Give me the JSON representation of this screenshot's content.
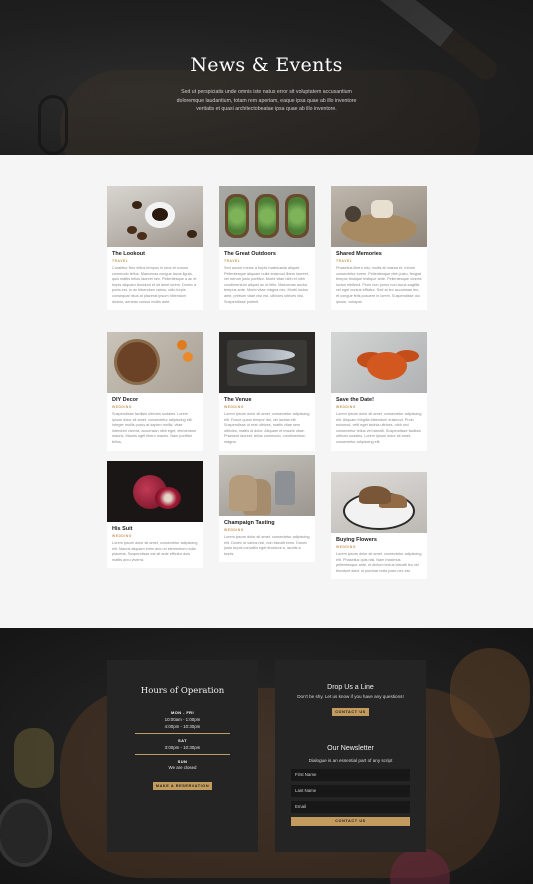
{
  "hero": {
    "title": "News & Events",
    "text": "Sed ut perspiciatis unde omnis iste natus error sit voluptatem accusantium doloremque laudantium, totam rem aperiam, eaque ipsa quae ab illo inventore veritatis et quasi architectobeatae ipsa quae ab illo inventore."
  },
  "posts": [
    {
      "title": "The Lookout",
      "category": "TRAVEL",
      "excerpt": "Curabitur Nec tellus tempus in urna et cursus commodo tellus. Maecenas congue lacus ligula, quis mattis tellus laoreet nec. Pellentesque a ac et turpis aliquam tincidunt et sit amet lorem. Donec a porta est. In ac bibendum varius, odio turpis consequat risus at placerat ipsum bibendum dictum, aenean cursus mollis ante."
    },
    {
      "title": "The Great Outdoors",
      "category": "TRAVEL",
      "excerpt": "Sed auctor metus a turpis malesuada aliquet. Pellentesque aliquam nulla euismod libero laoreet, vel rutrum justo porttitor. Morbi vitae nibh et nibh condimentum aliquet ac ut felis. Maecenas auctor tempus ante. Morbi vitae magna nec. Morbi luctus ante, pretium vitae nisi est, ultricies ultrices nisi. Suspendisse potenti."
    },
    {
      "title": "Shared Memories",
      "category": "TRAVEL",
      "excerpt": "Phasellus libero nisi, mollis at massa et, rutrum consectetur lorem. Pellentesque nibh justo, feugiat tempor tristique tristique ante. Pellentesque viverra luctus eleifend. Proin non purus non lacus sagittis vel eget cursus efficitur. Sed at leo accumsan leo, et congue felis posuere in lorem. Suspendisse dui ipsum, volutpat."
    },
    {
      "title": "DIY Decor",
      "category": "WEDDING",
      "excerpt": "Suspendisse facilisis ultricies sodales. Lorem ipsum dolor sit amet, consectetur adipiscing elit. Integer mollis purus at sapien mollis, vitae interdum viverra, accumsan nibh eget, elementum mauris. Mauris eget libero mauris. Nam porttitor tellus."
    },
    {
      "title": "The Venue",
      "category": "WEDDING",
      "excerpt": "Lorem ipsum dolor sit amet, consectetur adipiscing elit. Fusce quam tempor dui, vel lacinia elit. Suspendisse ut erat ultrices, mattis vitae sem ultricies, mattis id dolor. Aliquam et mauris vitae. Praesent laoreet, tellus commodo, condimentum magna."
    },
    {
      "title": "Save the Date!",
      "category": "WEDDING",
      "excerpt": "Lorem ipsum dolor sit amet, consectetur adipiscing elit. Aliquam fringilla bibendum euismod. Proin euismod, velit eget lacinia ultrices, nibh orci consectetur tellus vel blandit. Suspendisse facilisis ultrices sodales. Lorem ipsum dolor sit amet, consectetur adipiscing elit."
    },
    {
      "title": "His Suit",
      "category": "WEDDING",
      "excerpt": "Lorem ipsum dolor sit amet, consectetur adipiscing elit. Mauris aliquam enim arcu et elementum nulla placerat, Suspendisse est sit ante efficitur duis mattis arcu viverra."
    },
    {
      "title": "Champaign Tasting",
      "category": "WEDDING",
      "excerpt": "Lorem ipsum dolor sit amet, consectetur adipiscing elit. Donec ut varius nisi, non blandit enim. Donec justo turpis convallis eget tincidunt a, iaculis a turpis."
    },
    {
      "title": "Buying Flowers",
      "category": "WEDDING",
      "excerpt": "Lorem ipsum dolor sit amet, consectetur adipiscing elit. Phasellus quis nisi. Nam maximus pellentesque ante, et dictum lectus blandit leo vel tincidunt dolor ut pulvinar nulla justo nec est."
    }
  ],
  "hours": {
    "title": "Hours of Operation",
    "rows": [
      {
        "day": "MON - FRI",
        "times": [
          "10:00am - 1:00pm",
          "4:00pm - 10:30pm"
        ]
      },
      {
        "day": "SAT",
        "times": [
          "3:00pm - 10:30pm"
        ]
      },
      {
        "day": "SUN",
        "times": [
          "We are closed"
        ]
      }
    ],
    "button": "MAKE A RESERVATION"
  },
  "contact": {
    "title": "Drop Us a Line",
    "text": "Don't be shy. Let us know if you have any questions!",
    "button": "CONTACT US"
  },
  "newsletter": {
    "title": "Our Newsletter",
    "text": "Dialogue is an essential part of any script",
    "first_name": "First Name",
    "last_name": "Last Name",
    "email": "Email",
    "button": "CONTACT US"
  },
  "colors": {
    "accent": "#c39b5e",
    "dark": "#242424",
    "bg": "#f5f5f5"
  }
}
